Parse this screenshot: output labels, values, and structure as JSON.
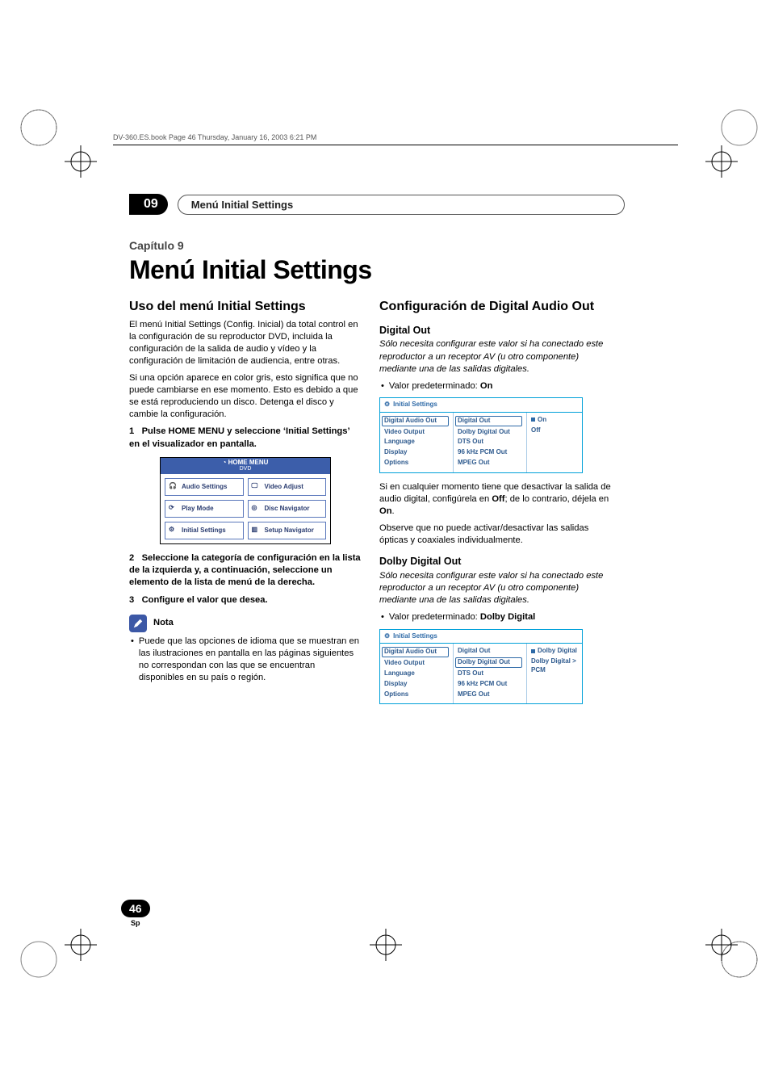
{
  "header": {
    "running": "DV-360.ES.book  Page 46  Thursday, January 16, 2003  6:21 PM"
  },
  "chapter": {
    "num": "09",
    "pill": "Menú Initial Settings",
    "subtitle": "Capítulo 9",
    "title": "Menú Initial Settings"
  },
  "left": {
    "h": "Uso del menú Initial Settings",
    "p1": "El menú Initial Settings (Config. Inicial) da total control en la configuración de su reproductor DVD, incluida la configuración de la salida de audio y vídeo y la configuración de limitación de audiencia, entre otras.",
    "p2": "Si una opción aparece en color gris, esto significa que no puede cambiarse en ese momento. Esto es debido a que se está reproduciendo un disco. Detenga el disco y cambie la configuración.",
    "s1n": "1",
    "s1": "Pulse HOME MENU y seleccione ‘Initial Settings’ en el visualizador en pantalla.",
    "home": {
      "title": "HOME MENU",
      "sub": "DVD",
      "c1": "Audio Settings",
      "c2": "Video Adjust",
      "c3": "Play Mode",
      "c4": "Disc Navigator",
      "c5": "Initial Settings",
      "c6": "Setup Navigator"
    },
    "s2n": "2",
    "s2": "Seleccione la categoría de configuración en la lista de la izquierda y, a continuación, seleccione un elemento de la lista de menú de la derecha.",
    "s3n": "3",
    "s3": "Configure el valor que desea.",
    "note_label": "Nota",
    "note_b1": "Puede que las opciones de idioma que se muestran en las ilustraciones en pantalla en las páginas siguientes no correspondan con las que se encuentran disponibles en su país o región."
  },
  "right": {
    "h": "Configuración de Digital Audio Out",
    "digout": {
      "h": "Digital Out",
      "note": "Sólo necesita configurar este valor si ha conectado este reproductor a un receptor AV (u otro componente) mediante una de las salidas digitales.",
      "default_pre": "Valor predeterminado: ",
      "default_val": "On"
    },
    "box1": {
      "head": "Initial Settings",
      "leftItems": [
        "Digital Audio Out",
        "Video Output",
        "Language",
        "Display",
        "Options"
      ],
      "midItems": [
        "Digital Out",
        "Dolby Digital Out",
        "DTS Out",
        "96 kHz PCM Out",
        "MPEG Out"
      ],
      "rightItems": [
        "On",
        "Off"
      ]
    },
    "p_after1a": "Si en cualquier momento tiene que desactivar la salida de audio digital, configúrela en ",
    "p_after1a_bold": "Off",
    "p_after1a_end": "; de lo contrario, déjela en ",
    "p_after1a_bold2": "On",
    "p_after1b": "Observe que no puede activar/desactivar las salidas ópticas y coaxiales individualmente.",
    "dolby": {
      "h": "Dolby Digital Out",
      "note": "Sólo necesita configurar este valor si ha conectado este reproductor a un receptor AV (u otro componente) mediante una de las salidas digitales.",
      "default_pre": "Valor predeterminado: ",
      "default_val": "Dolby Digital"
    },
    "box2": {
      "head": "Initial Settings",
      "leftItems": [
        "Digital Audio Out",
        "Video Output",
        "Language",
        "Display",
        "Options"
      ],
      "midItems": [
        "Digital Out",
        "Dolby Digital Out",
        "DTS Out",
        "96 kHz PCM Out",
        "MPEG Out"
      ],
      "rightItems": [
        "Dolby Digital",
        "Dolby Digital > PCM"
      ]
    }
  },
  "footer": {
    "page": "46",
    "lang": "Sp"
  }
}
